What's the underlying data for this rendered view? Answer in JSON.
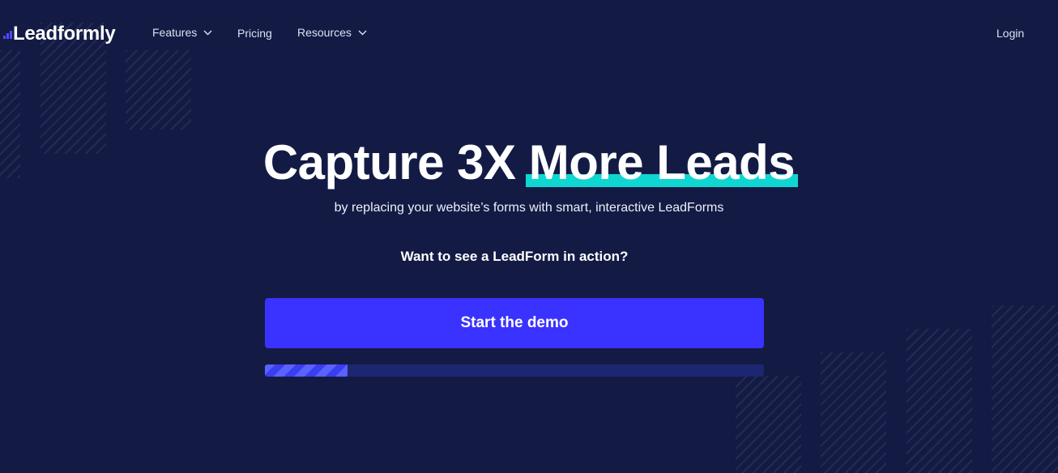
{
  "brand": {
    "name": "Leadformly"
  },
  "nav": {
    "features": "Features",
    "pricing": "Pricing",
    "resources": "Resources",
    "login": "Login"
  },
  "hero": {
    "title_part1": "Capture 3X ",
    "title_highlight": "More Leads",
    "subtitle": "by replacing your website’s forms with smart, interactive LeadForms",
    "question": "Want to see a LeadForm in action?",
    "cta": "Start the demo"
  },
  "progress": {
    "value_fraction": 0.165
  },
  "colors": {
    "background": "#131b45",
    "accent_highlight": "#0fd6d0",
    "button": "#3a32ff",
    "progress_track": "#1d2670"
  },
  "icons": {
    "features_dropdown": "chevron-down-icon",
    "resources_dropdown": "chevron-down-icon"
  }
}
